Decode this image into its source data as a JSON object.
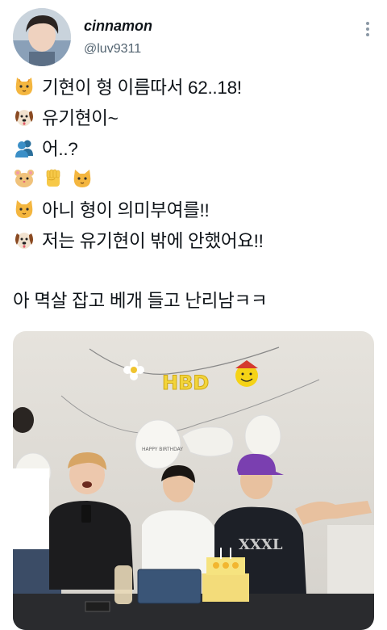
{
  "user": {
    "display_name": "cinnamon",
    "handle": "@luv9311"
  },
  "tweet": {
    "lines": [
      {
        "icon": "cat-face-icon",
        "text": "기현이 형 이름따서 62..18!"
      },
      {
        "icon": "dog-face-icon",
        "text": "유기현이~"
      },
      {
        "icon": "busts-in-silhouette-icon",
        "text": "어..?"
      },
      {
        "icon": "hamster-face-icon",
        "text": ""
      },
      {
        "icon": "cat-face-icon",
        "text": "아니 형이 의미부여를!!"
      },
      {
        "icon": "dog-face-icon",
        "text": "저는 유기현이 밖에 안했어요!!"
      }
    ],
    "closing": "아 멱살 잡고 베개 들고 난리남ㅋㅋ"
  },
  "media": {
    "banner_text": "HBD",
    "balloon_text": "HAPPY BIRTHDAY",
    "shirt_text": "XXXL"
  },
  "colors": {
    "text": "#0f1419",
    "secondary": "#536471"
  }
}
